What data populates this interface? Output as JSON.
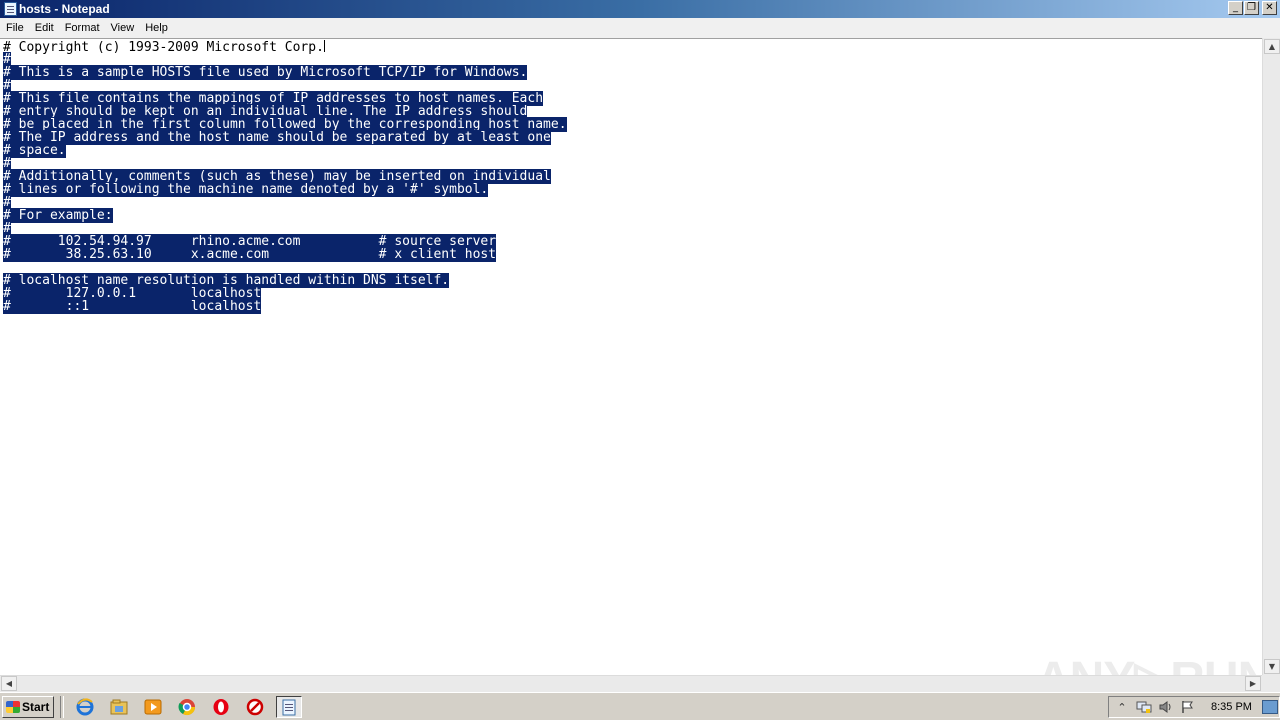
{
  "window": {
    "title": "hosts - Notepad",
    "minimize_label": "_",
    "restore_label": "❐",
    "close_label": "✕"
  },
  "menu": {
    "items": [
      {
        "label": "File"
      },
      {
        "label": "Edit"
      },
      {
        "label": "Format"
      },
      {
        "label": "View"
      },
      {
        "label": "Help"
      }
    ]
  },
  "editor": {
    "lines": [
      "# Copyright (c) 1993-2009 Microsoft Corp.",
      "#",
      "# This is a sample HOSTS file used by Microsoft TCP/IP for Windows.",
      "#",
      "# This file contains the mappings of IP addresses to host names. Each",
      "# entry should be kept on an individual line. The IP address should",
      "# be placed in the first column followed by the corresponding host name.",
      "# The IP address and the host name should be separated by at least one",
      "# space.",
      "#",
      "# Additionally, comments (such as these) may be inserted on individual",
      "# lines or following the machine name denoted by a '#' symbol.",
      "#",
      "# For example:",
      "#",
      "#      102.54.94.97     rhino.acme.com          # source server",
      "#       38.25.63.10     x.acme.com              # x client host",
      "",
      "# localhost name resolution is handled within DNS itself.",
      "#\t127.0.0.1       localhost",
      "#\t::1             localhost"
    ]
  },
  "watermark": "ANY▷RUN",
  "taskbar": {
    "start_label": "Start",
    "clock": "8:35 PM",
    "icons": [
      "ie-icon",
      "explorer-icon",
      "media-player-icon",
      "chrome-icon",
      "opera-icon",
      "security-icon",
      "notepad-icon"
    ]
  }
}
